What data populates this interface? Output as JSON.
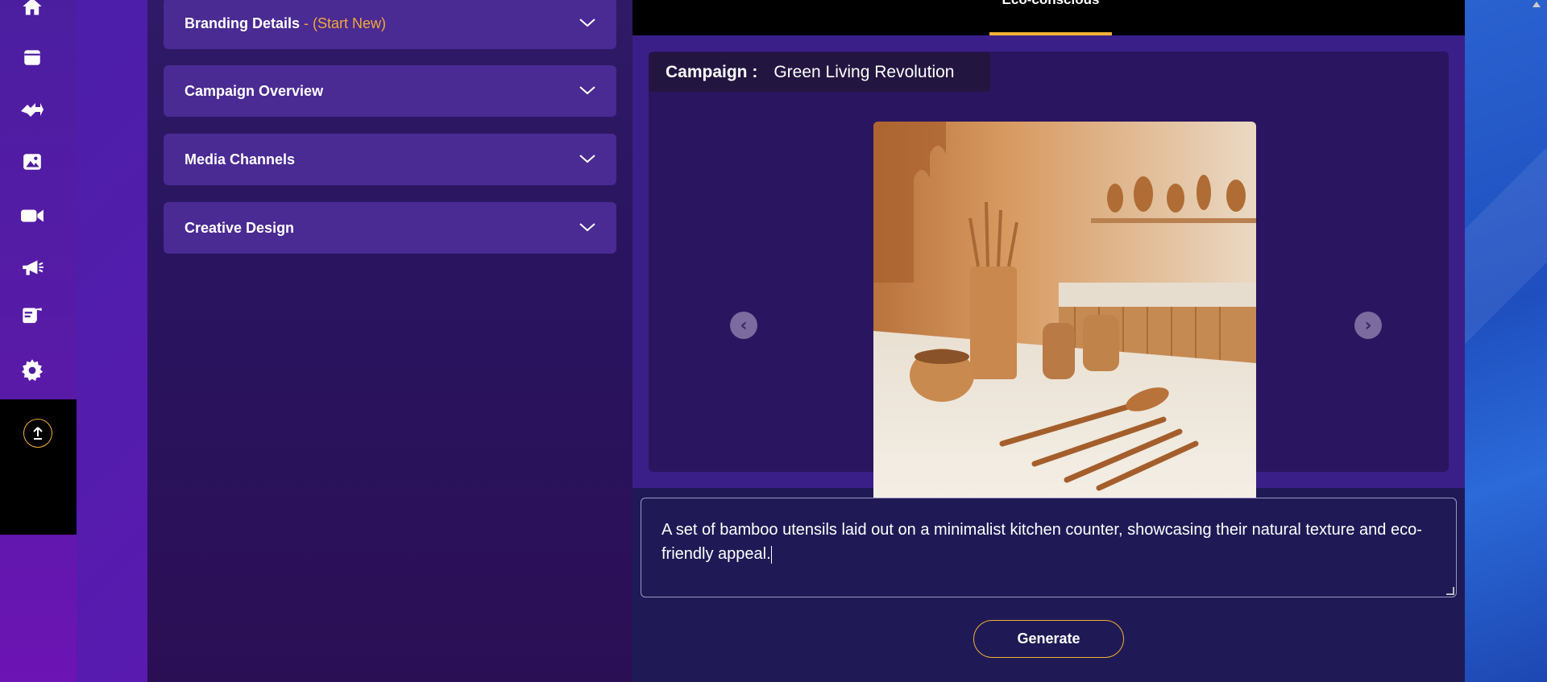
{
  "rail": {
    "icons": [
      "home-icon",
      "calendar-icon",
      "campaign-wizard-icon",
      "image-icon",
      "video-icon",
      "megaphone-icon",
      "audio-script-icon",
      "settings-icon"
    ],
    "upload_icon": "upload-icon",
    "accent_color": "#f2b035"
  },
  "left_panel": {
    "accordions": [
      {
        "title": "Branding Details",
        "subtitle": " - (Start New)"
      },
      {
        "title": "Campaign Overview",
        "subtitle": ""
      },
      {
        "title": "Media Channels",
        "subtitle": ""
      },
      {
        "title": "Creative Design",
        "subtitle": ""
      }
    ]
  },
  "main": {
    "active_tab": "Eco-conscious",
    "campaign_key": "Campaign :",
    "campaign_value": "Green Living Revolution",
    "prompt_text": "A set of bamboo utensils laid out on a minimalist kitchen counter, showcasing their natural texture and eco-friendly appeal.",
    "generate_label": "Generate"
  },
  "colors": {
    "accent": "#f2b035",
    "panel_bg": "#1f1a55",
    "accordion_bg": "#4a2a93",
    "subtitle_orange": "#f2a83a"
  }
}
